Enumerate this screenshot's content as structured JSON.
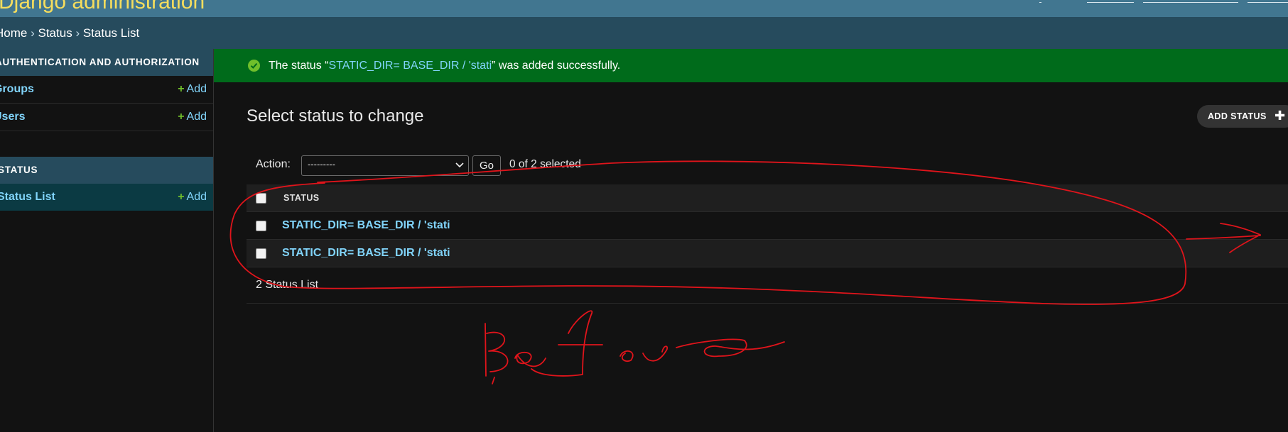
{
  "header": {
    "site_name": "Django administration"
  },
  "breadcrumbs": {
    "home": "Home",
    "app": "Status",
    "current": "Status List",
    "separator": "›"
  },
  "sidebar": {
    "modules": [
      {
        "caption": "AUTHENTICATION AND AUTHORIZATION",
        "rows": [
          {
            "label": "Groups",
            "add": "Add"
          },
          {
            "label": "Users",
            "add": "Add"
          }
        ]
      },
      {
        "caption": "STATUS",
        "rows": [
          {
            "label": "Status List",
            "add": "Add"
          }
        ]
      }
    ]
  },
  "messages": {
    "success": {
      "prefix": "The status “",
      "object": "STATIC_DIR= BASE_DIR / 'stati",
      "suffix": "” was added successfully."
    }
  },
  "content": {
    "title": "Select status to change",
    "add_button": "ADD STATUS"
  },
  "actions": {
    "label": "Action:",
    "select_value": "---------",
    "go": "Go",
    "selected": "0 of 2 selected"
  },
  "table": {
    "column": "STATUS",
    "rows": [
      {
        "status": "STATIC_DIR= BASE_DIR / 'stati"
      },
      {
        "status": "STATIC_DIR= BASE_DIR / 'stati"
      }
    ]
  },
  "paginator": {
    "text": "2 Status List"
  },
  "annotation": {
    "color": "#e0141b"
  },
  "colors": {
    "header": "#417690",
    "breadcrumbs": "#264b5d",
    "success": "#006b1b",
    "link": "#81d4fa",
    "add_plus": "#70bf2b",
    "site_name": "#f5dd5d"
  }
}
